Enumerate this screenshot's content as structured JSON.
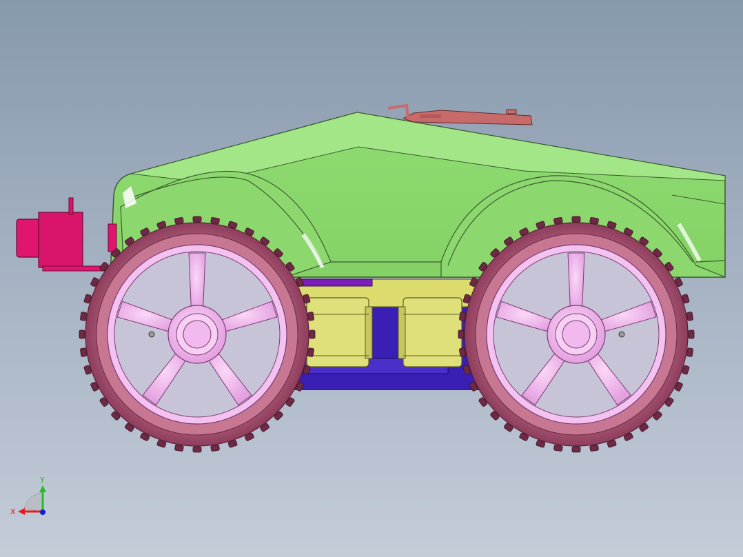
{
  "viewport": {
    "background_top": "#8799ad",
    "background_bottom": "#c4ccd8"
  },
  "model": {
    "body_color": "#93df76",
    "body_edge_color": "#3c5a2c",
    "tire_color": "#b9627e",
    "tire_tread_color": "#6e2a45",
    "rim_color": "#f2b5ee",
    "chassis_color": "#3a1fb5",
    "motor_color": "#dfe07a",
    "sensor_color": "#e0166e",
    "board_color": "#c76a6a"
  },
  "triad": {
    "x_label": "X",
    "y_label": "Y",
    "x_color": "#e02020",
    "y_color": "#20c020",
    "z_color": "#1020d0"
  }
}
